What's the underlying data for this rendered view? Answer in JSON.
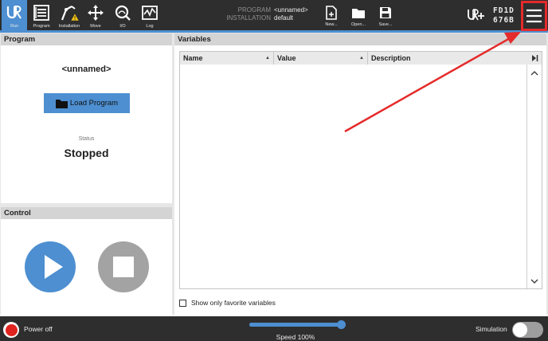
{
  "header": {
    "nav": [
      {
        "label": "Run",
        "icon": "ur-logo-icon"
      },
      {
        "label": "Program",
        "icon": "program-icon"
      },
      {
        "label": "Installation",
        "icon": "installation-icon"
      },
      {
        "label": "Move",
        "icon": "move-icon"
      },
      {
        "label": "I/O",
        "icon": "io-icon"
      },
      {
        "label": "Log",
        "icon": "log-icon"
      }
    ],
    "program_label": "PROGRAM",
    "program_value": "<unnamed>",
    "installation_label": "INSTALLATION",
    "installation_value": "default",
    "file_buttons": [
      {
        "label": "New...",
        "icon": "new-file-icon"
      },
      {
        "label": "Open...",
        "icon": "folder-icon"
      },
      {
        "label": "Save...",
        "icon": "save-icon"
      }
    ],
    "robot_id_line1": "FD1D",
    "robot_id_line2": "676B",
    "menu_icon": "hamburger-menu-icon"
  },
  "program_panel": {
    "title": "Program",
    "program_name": "<unnamed>",
    "load_button": "Load Program",
    "status_label": "Status",
    "status_value": "Stopped"
  },
  "control_panel": {
    "title": "Control",
    "play_icon": "play-icon",
    "stop_icon": "stop-icon"
  },
  "variables_panel": {
    "title": "Variables",
    "columns": [
      "Name",
      "Value",
      "Description"
    ],
    "rows": [],
    "favorites_checkbox_label": "Show only favorite variables",
    "favorites_checked": false
  },
  "footer": {
    "power_label": "Power off",
    "speed_label": "Speed 100%",
    "speed_value": 1.0,
    "simulation_label": "Simulation",
    "simulation_on": false
  },
  "colors": {
    "accent": "#4d8fd1",
    "header_bg": "#2e2e2e",
    "annotation_red": "#e52b2b",
    "stop_gray": "#a3a3a3"
  }
}
